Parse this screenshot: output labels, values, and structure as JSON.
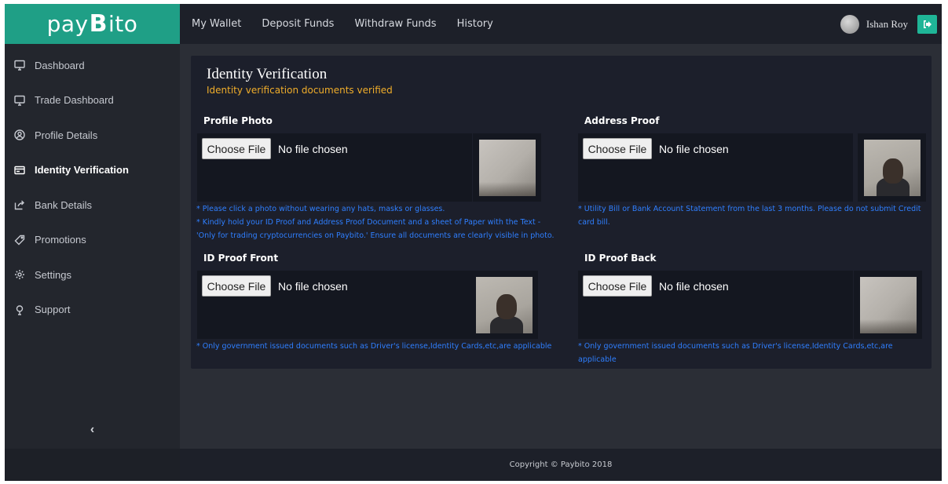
{
  "brand": {
    "prefix": "pay",
    "b": "B",
    "suffix": "ito"
  },
  "sidebar": {
    "items": [
      {
        "label": "Dashboard",
        "icon": "monitor-icon"
      },
      {
        "label": "Trade Dashboard",
        "icon": "monitor-icon"
      },
      {
        "label": "Profile Details",
        "icon": "user-circle-icon"
      },
      {
        "label": "Identity Verification",
        "icon": "id-card-icon",
        "active": true
      },
      {
        "label": "Bank Details",
        "icon": "share-icon"
      },
      {
        "label": "Promotions",
        "icon": "tag-icon"
      },
      {
        "label": "Settings",
        "icon": "gear-icon"
      },
      {
        "label": "Support",
        "icon": "support-icon"
      }
    ],
    "collapse_label": "‹"
  },
  "topnav": {
    "items": [
      "My Wallet",
      "Deposit Funds",
      "Withdraw Funds",
      "History"
    ]
  },
  "user": {
    "name": "Ishan Roy"
  },
  "card": {
    "title": "Identity Verification",
    "status": "Identity verification documents verified",
    "choose_label": "Choose File",
    "no_file_label": "No file chosen",
    "sections": {
      "profile_photo": {
        "label": "Profile Photo"
      },
      "address_proof": {
        "label": "Address Proof"
      },
      "id_front": {
        "label": "ID Proof Front"
      },
      "id_back": {
        "label": "ID Proof Back"
      }
    },
    "notes": {
      "profile_1": "* Please click a photo without wearing any hats, masks or glasses.",
      "profile_2": "* Kindly hold your ID Proof and Address Proof Document and a sheet of Paper with the Text - 'Only for trading cryptocurrencies on Paybito.' Ensure all documents are clearly visible in photo.",
      "address": "* Utility Bill or Bank Account Statement from the last 3 months. Please do not submit Credit card bill.",
      "id_front": "* Only government issued documents such as Driver's license,Identity Cards,etc,are applicable",
      "id_back": "* Only government issued documents such as Driver's license,Identity Cards,etc,are applicable"
    }
  },
  "footer": {
    "copyright": "Copyright © Paybito 2018"
  },
  "colors": {
    "brand": "#1f9f86",
    "accent": "#1fb597",
    "status": "#f0ad2a",
    "note": "#2f7fff"
  }
}
